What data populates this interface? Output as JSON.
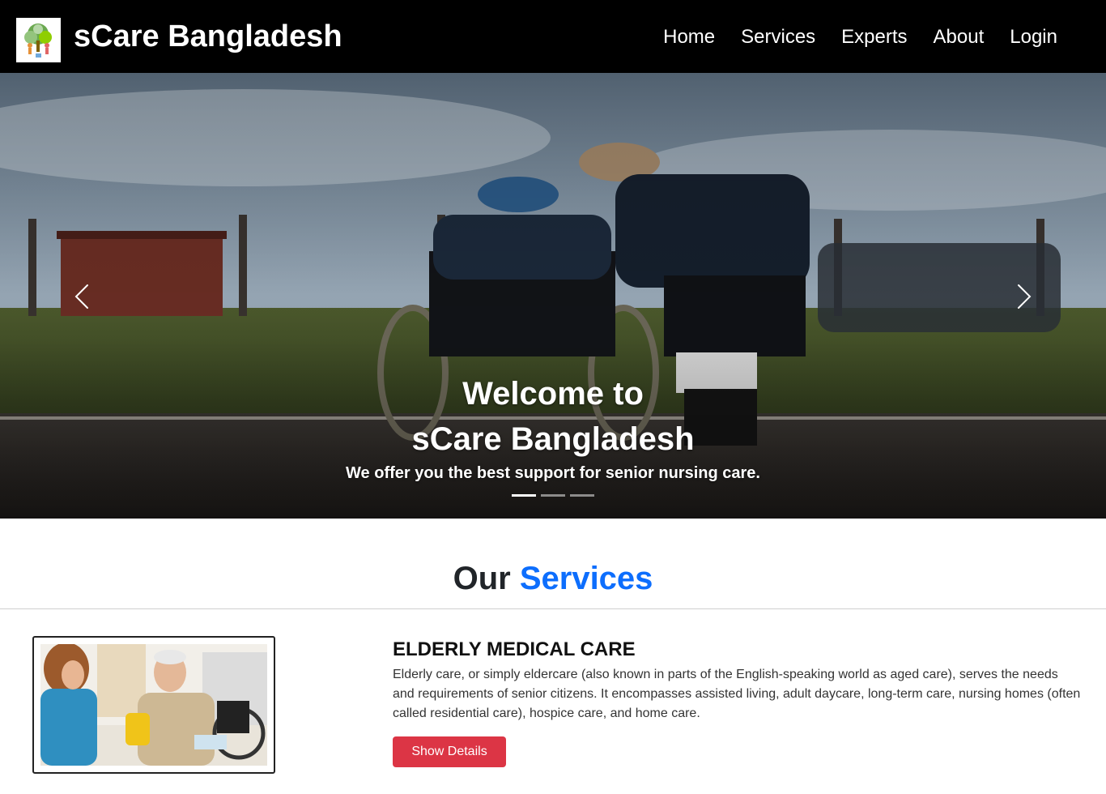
{
  "navbar": {
    "brand": "sCare Bangladesh",
    "logo_icon": "tree-people-logo-icon",
    "links": [
      "Home",
      "Services",
      "Experts",
      "About",
      "Login"
    ]
  },
  "hero": {
    "title_line1": "Welcome to",
    "title_line2": "sCare Bangladesh",
    "subtitle": "We offer you the best support for senior nursing care.",
    "slides_total": 3,
    "active_slide": 1,
    "prev_icon": "chevron-left-icon",
    "next_icon": "chevron-right-icon"
  },
  "services": {
    "heading_plain": "Our",
    "heading_accent": "Services",
    "accent_color": "#0d6efd",
    "items": [
      {
        "title": "ELDERLY MEDICAL CARE",
        "description": "Elderly care, or simply eldercare (also known in parts of the English-speaking world as aged care), serves the needs and requirements of senior citizens. It encompasses assisted living, adult daycare, long-term care, nursing homes (often called residential care), hospice care, and home care.",
        "button_label": "Show Details",
        "button_color": "#dc3545"
      }
    ]
  }
}
